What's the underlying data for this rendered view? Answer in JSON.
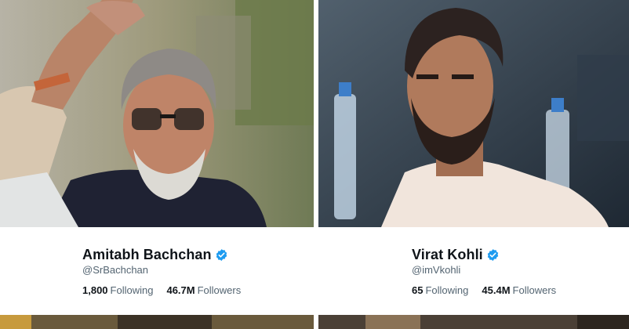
{
  "profiles": [
    {
      "name": "Amitabh Bachchan",
      "handle": "@SrBachchan",
      "following_count": "1,800",
      "following_label": "Following",
      "followers_count": "46.7M",
      "followers_label": "Followers",
      "verified": true
    },
    {
      "name": "Virat Kohli",
      "handle": "@imVkohli",
      "following_count": "65",
      "following_label": "Following",
      "followers_count": "45.4M",
      "followers_label": "Followers",
      "verified": true
    }
  ],
  "colors": {
    "verified_badge": "#1d9bf0",
    "name_text": "#0f1419",
    "secondary_text": "#536471"
  }
}
